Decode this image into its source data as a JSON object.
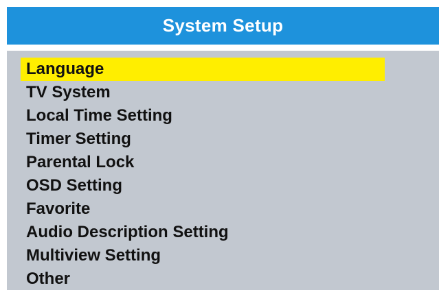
{
  "header": {
    "title": "System Setup"
  },
  "menu": {
    "selected_index": 0,
    "items": [
      {
        "label": "Language"
      },
      {
        "label": "TV System"
      },
      {
        "label": "Local Time Setting"
      },
      {
        "label": "Timer Setting"
      },
      {
        "label": "Parental Lock"
      },
      {
        "label": "OSD Setting"
      },
      {
        "label": "Favorite"
      },
      {
        "label": "Audio Description Setting"
      },
      {
        "label": "Multiview Setting"
      },
      {
        "label": "Other"
      }
    ]
  },
  "colors": {
    "title_bar": "#1e92dc",
    "panel_background": "#c2c8d0",
    "highlight": "#ffee00"
  }
}
